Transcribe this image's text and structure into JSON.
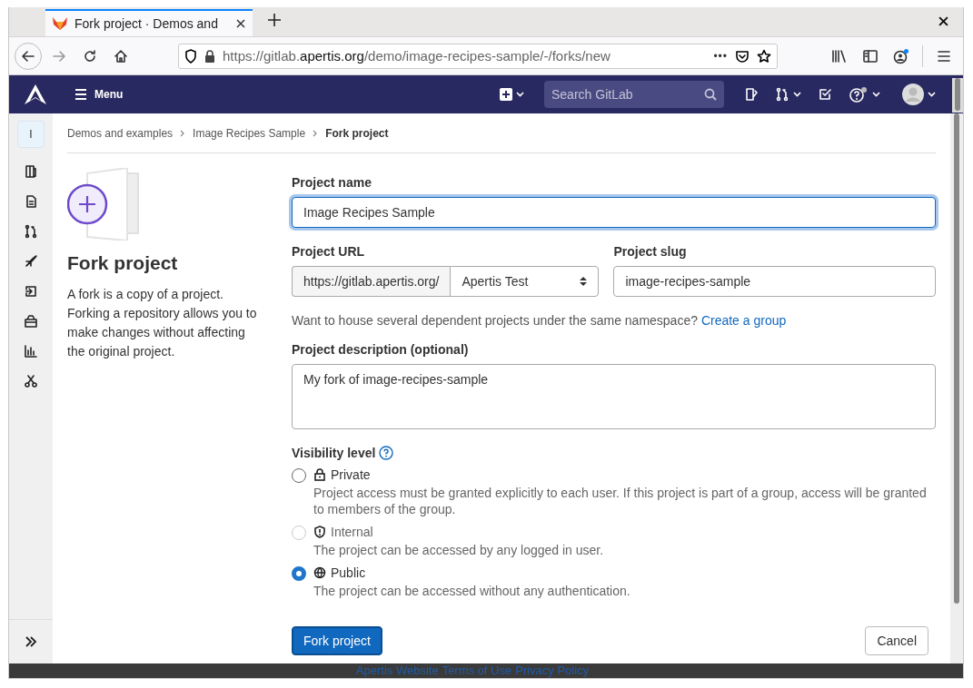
{
  "browser": {
    "tab_title": "Fork project · Demos and",
    "url_prefix": "https://gitlab.",
    "url_host": "apertis.org",
    "url_path": "/demo/image-recipes-sample/-/forks/new",
    "url_more": "•••"
  },
  "navbar": {
    "menu_label": "Menu",
    "search_placeholder": "Search GitLab"
  },
  "sidebar": {
    "project_initial": "I"
  },
  "breadcrumbs": [
    {
      "label": "Demos and examples",
      "current": false
    },
    {
      "label": "Image Recipes Sample",
      "current": false
    },
    {
      "label": "Fork project",
      "current": true
    }
  ],
  "intro": {
    "title": "Fork project",
    "description": "A fork is a copy of a project. Forking a repository allows you to make changes without affecting the original project."
  },
  "form": {
    "project_name": {
      "label": "Project name",
      "value": "Image Recipes Sample",
      "focused": true
    },
    "project_url": {
      "label": "Project URL",
      "prefix": "https://gitlab.apertis.org/",
      "namespace": "Apertis Test"
    },
    "project_slug": {
      "label": "Project slug",
      "value": "image-recipes-sample"
    },
    "group_hint": {
      "text": "Want to house several dependent projects under the same namespace?",
      "link": "Create a group"
    },
    "description": {
      "label": "Project description (optional)",
      "value": "My fork of image-recipes-sample"
    },
    "visibility": {
      "label": "Visibility level",
      "options": [
        {
          "kind": "private",
          "label": "Private",
          "description": "Project access must be granted explicitly to each user. If this project is part of a group, access will be granted to members of the group.",
          "selected": false,
          "disabled": false
        },
        {
          "kind": "internal",
          "label": "Internal",
          "description": "The project can be accessed by any logged in user.",
          "selected": false,
          "disabled": true
        },
        {
          "kind": "public",
          "label": "Public",
          "description": "The project can be accessed without any authentication.",
          "selected": true,
          "disabled": false
        }
      ]
    },
    "submit": "Fork project",
    "cancel": "Cancel"
  },
  "footer": {
    "links": [
      "Apertis Website",
      "Terms of Use",
      "Privacy Policy"
    ]
  }
}
